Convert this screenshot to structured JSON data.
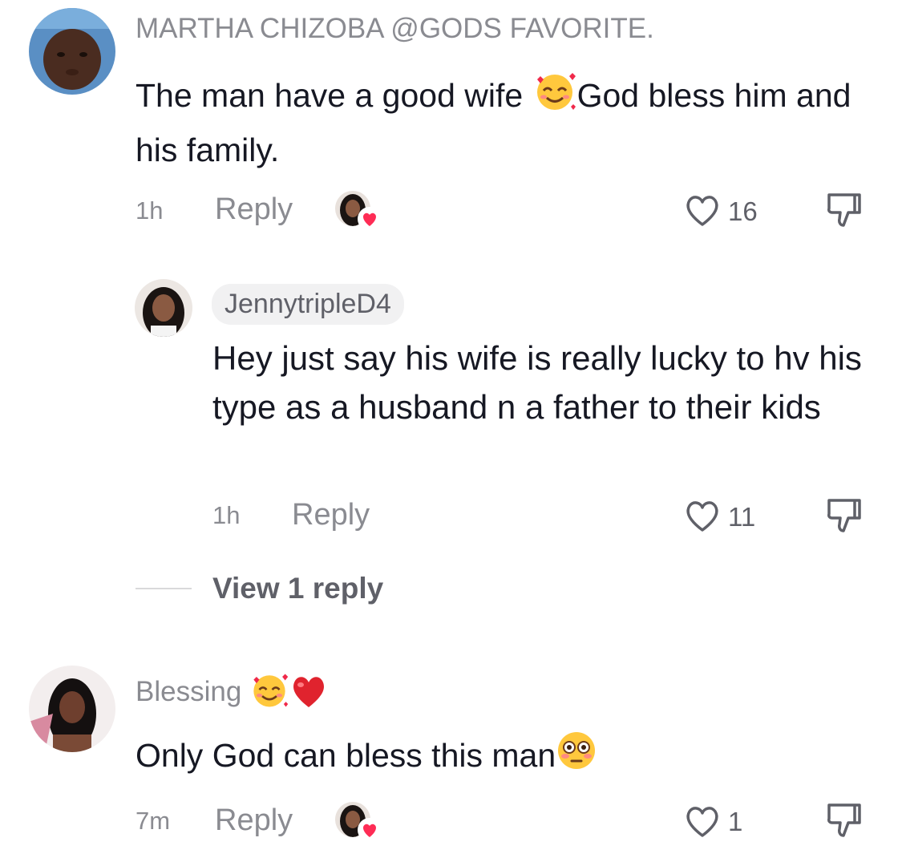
{
  "comments": [
    {
      "username": "MARTHA CHIZOBA @GODS FAVORITE.",
      "text_part1": "The man have a good wife ",
      "text_emoji": "smiling-face-with-hearts",
      "text_part2": "God bless him and his family.",
      "time": "1h",
      "reply_label": "Reply",
      "likes": "16",
      "creator_liked": true,
      "replies": [
        {
          "username": "JennytripleD4",
          "is_creator": true,
          "text": "Hey just say his wife is really lucky to hv his type as a husband n a father to their kids",
          "time": "1h",
          "reply_label": "Reply",
          "likes": "11"
        }
      ],
      "view_more_label": "View 1 reply"
    },
    {
      "username": "Blessing",
      "username_emojis": [
        "smiling-face-with-hearts",
        "red-heart"
      ],
      "text": "Only God can bless this man",
      "text_emoji": "flushed-face",
      "time": "7m",
      "reply_label": "Reply",
      "likes": "1",
      "creator_liked": true
    }
  ],
  "colors": {
    "primary_text": "#161823",
    "secondary_text": "#8a8b91",
    "like_heart_badge": "#fe2c55"
  },
  "icons": [
    "like-heart-icon",
    "dislike-icon",
    "creator-liked-badge"
  ]
}
